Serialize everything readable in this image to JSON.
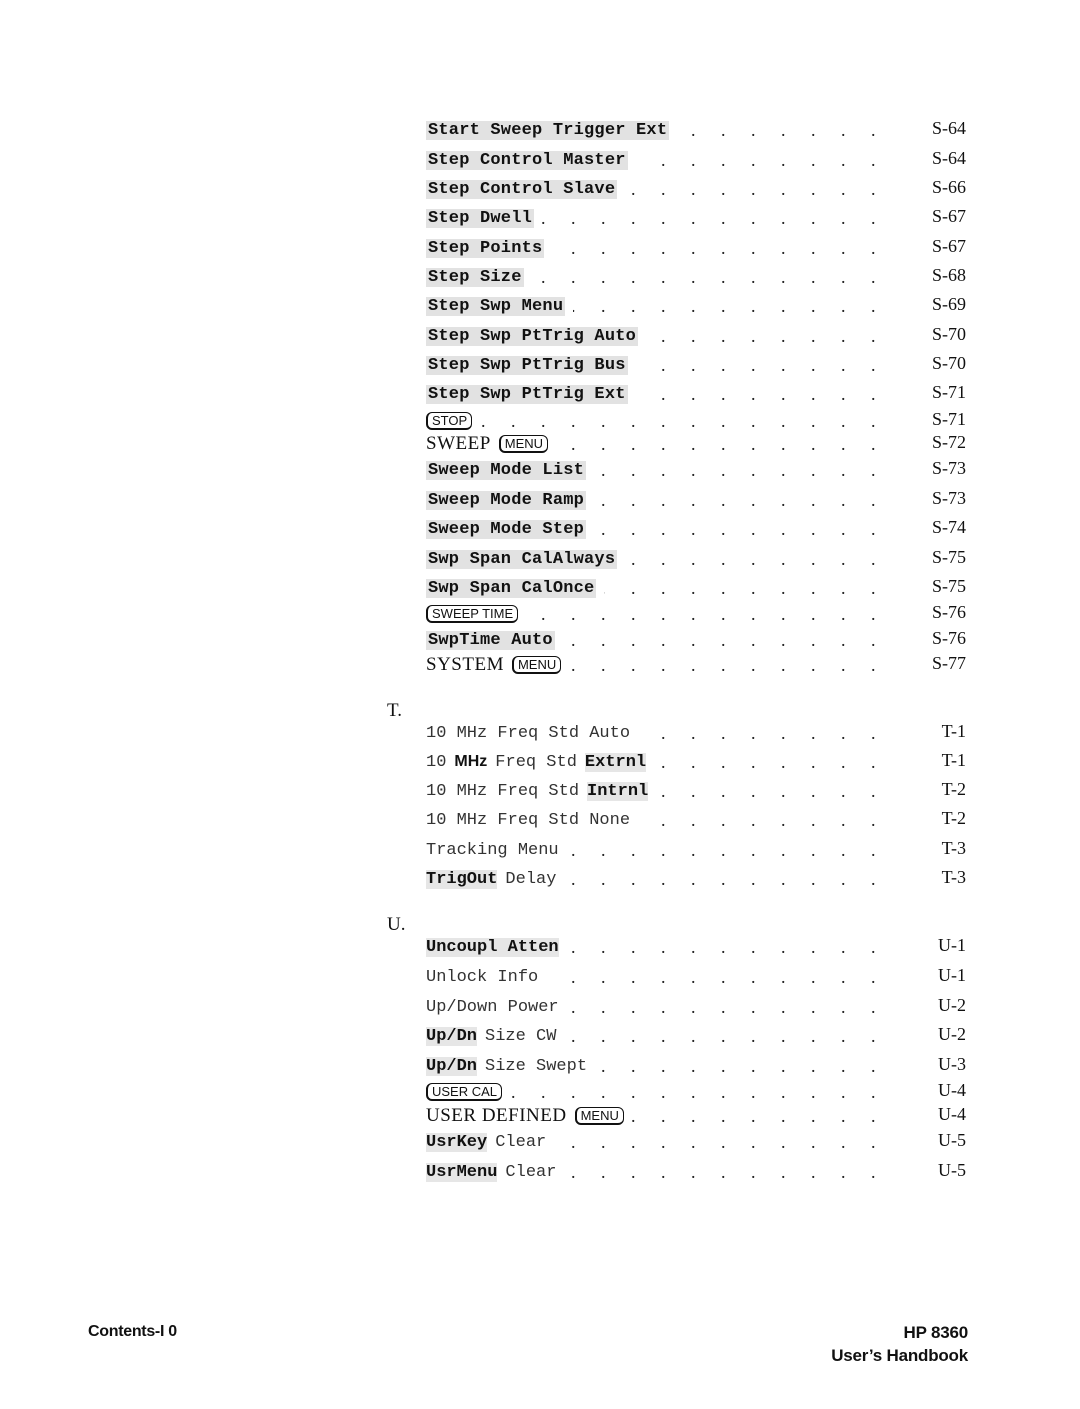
{
  "sections": {
    "S": {
      "entries": [
        {
          "parts": [
            {
              "style": "softkey",
              "text": "Start Sweep Trigger Ext"
            }
          ],
          "page": "S-64"
        },
        {
          "parts": [
            {
              "style": "softkey",
              "text": "Step Control Master"
            }
          ],
          "page": "S-64"
        },
        {
          "parts": [
            {
              "style": "softkey",
              "text": "Step Control Slave"
            }
          ],
          "page": "S-66"
        },
        {
          "parts": [
            {
              "style": "softkey",
              "text": "Step Dwell"
            }
          ],
          "page": "S-67"
        },
        {
          "parts": [
            {
              "style": "softkey",
              "text": "Step Points"
            }
          ],
          "page": "S-67"
        },
        {
          "parts": [
            {
              "style": "softkey",
              "text": "Step Size"
            }
          ],
          "page": "S-68"
        },
        {
          "parts": [
            {
              "style": "softkey",
              "text": "Step Swp Menu"
            }
          ],
          "page": "S-69"
        },
        {
          "parts": [
            {
              "style": "softkey",
              "text": "Step Swp PtTrig Auto"
            }
          ],
          "page": "S-70"
        },
        {
          "parts": [
            {
              "style": "softkey",
              "text": "Step Swp PtTrig Bus"
            }
          ],
          "page": "S-70"
        },
        {
          "parts": [
            {
              "style": "softkey",
              "text": "Step Swp PtTrig Ext"
            }
          ],
          "page": "S-71"
        },
        {
          "parts": [
            {
              "style": "hardkey",
              "text": "STOP"
            }
          ],
          "page": "S-71"
        },
        {
          "parts": [
            {
              "style": "serif",
              "text": "SWEEP"
            },
            {
              "style": "hardkey",
              "text": "MENU"
            }
          ],
          "page": "S-72"
        },
        {
          "parts": [
            {
              "style": "softkey",
              "text": "Sweep Mode List"
            }
          ],
          "page": "S-73"
        },
        {
          "parts": [
            {
              "style": "softkey",
              "text": "Sweep Mode Ramp"
            }
          ],
          "page": "S-73"
        },
        {
          "parts": [
            {
              "style": "softkey",
              "text": "Sweep Mode Step"
            }
          ],
          "page": "S-74"
        },
        {
          "parts": [
            {
              "style": "softkey",
              "text": "Swp Span CalAlways"
            }
          ],
          "page": "S-75"
        },
        {
          "parts": [
            {
              "style": "softkey",
              "text": "Swp Span CalOnce"
            }
          ],
          "page": "S-75"
        },
        {
          "parts": [
            {
              "style": "hardkey",
              "text": "SWEEP TIME"
            }
          ],
          "page": "S-76"
        },
        {
          "parts": [
            {
              "style": "softkey",
              "text": "SwpTime Auto"
            }
          ],
          "page": "S-76"
        },
        {
          "parts": [
            {
              "style": "serif",
              "text": "SYSTEM"
            },
            {
              "style": "hardkey",
              "text": "MENU"
            }
          ],
          "page": "S-77"
        }
      ]
    },
    "T": {
      "letter": "T.",
      "entries": [
        {
          "parts": [
            {
              "style": "plain",
              "text": "10 MHz Freq Std Auto"
            }
          ],
          "page": "T-1"
        },
        {
          "parts": [
            {
              "style": "plain",
              "text": "10"
            },
            {
              "style": "sansbold",
              "text": "MHz"
            },
            {
              "style": "plain",
              "text": "Freq Std"
            },
            {
              "style": "bold",
              "text": "Extrnl"
            }
          ],
          "page": "T-1"
        },
        {
          "parts": [
            {
              "style": "plain",
              "text": "10 MHz Freq Std"
            },
            {
              "style": "bold",
              "text": "Intrnl"
            }
          ],
          "page": "T-2"
        },
        {
          "parts": [
            {
              "style": "plain",
              "text": "10 MHz Freq Std None"
            }
          ],
          "page": "T-2"
        },
        {
          "parts": [
            {
              "style": "plain",
              "text": "Tracking Menu"
            }
          ],
          "page": "T-3"
        },
        {
          "parts": [
            {
              "style": "bold",
              "text": "TrigOut"
            },
            {
              "style": "plain",
              "text": "Delay"
            }
          ],
          "page": "T-3"
        }
      ]
    },
    "U": {
      "letter": "U.",
      "entries": [
        {
          "parts": [
            {
              "style": "bold",
              "text": "Uncoupl Atten"
            }
          ],
          "page": "U-1"
        },
        {
          "parts": [
            {
              "style": "plain",
              "text": "Unlock Info"
            }
          ],
          "page": "U-1"
        },
        {
          "parts": [
            {
              "style": "plain",
              "text": "Up/Down Power"
            }
          ],
          "page": "U-2"
        },
        {
          "parts": [
            {
              "style": "bold",
              "text": "Up/Dn"
            },
            {
              "style": "plain",
              "text": "Size CW"
            }
          ],
          "page": "U-2"
        },
        {
          "parts": [
            {
              "style": "bold",
              "text": "Up/Dn"
            },
            {
              "style": "plain",
              "text": "Size Swept"
            }
          ],
          "page": "U-3"
        },
        {
          "parts": [
            {
              "style": "hardkey",
              "text": "USER CAL"
            }
          ],
          "page": "U-4"
        },
        {
          "parts": [
            {
              "style": "serif",
              "text": "USER DEFINED"
            },
            {
              "style": "hardkey",
              "text": "MENU"
            }
          ],
          "page": "U-4"
        },
        {
          "parts": [
            {
              "style": "bold",
              "text": "UsrKey"
            },
            {
              "style": "plain",
              "text": "Clear"
            }
          ],
          "page": "U-5"
        },
        {
          "parts": [
            {
              "style": "bold",
              "text": "UsrMenu"
            },
            {
              "style": "plain",
              "text": "Clear"
            }
          ],
          "page": "U-5"
        }
      ]
    }
  },
  "footer": {
    "left": "Contents-I 0",
    "right_line1": "HP 8360",
    "right_line2": "User’s Handbook"
  }
}
